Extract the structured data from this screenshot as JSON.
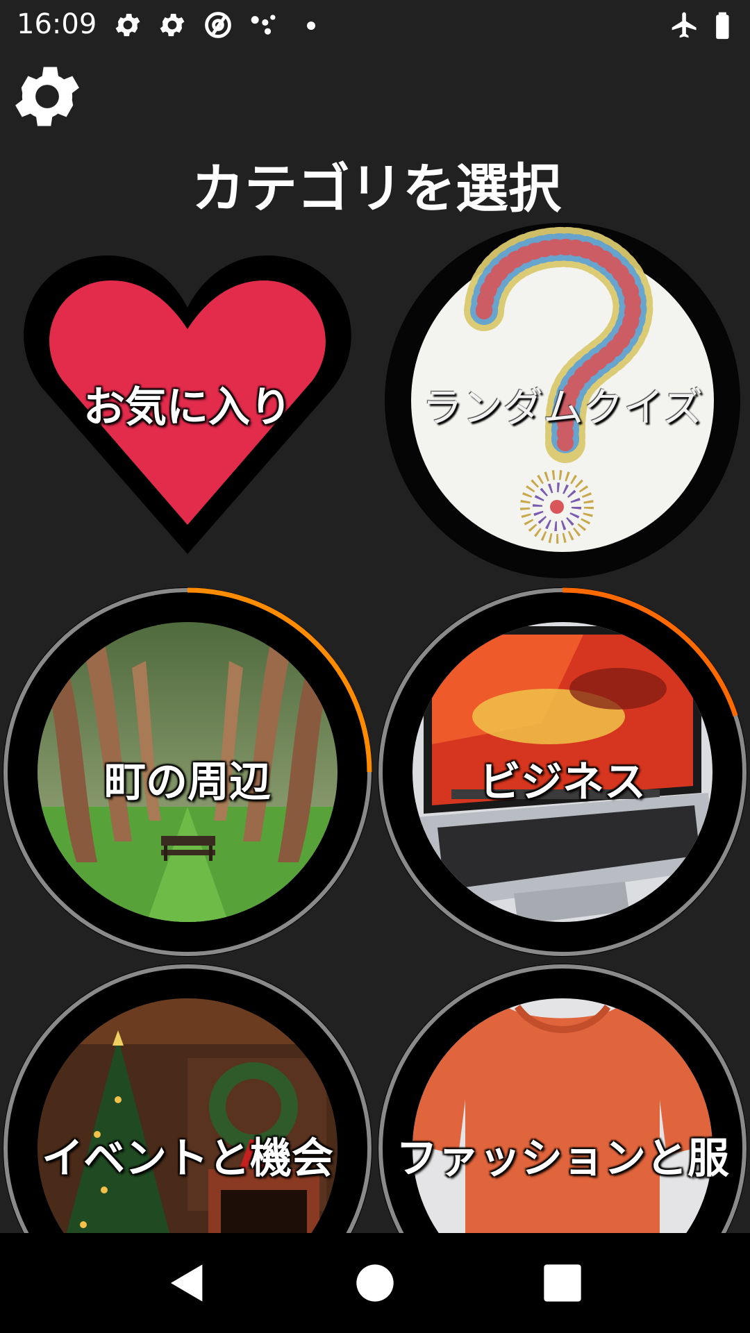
{
  "status_bar": {
    "time": "16:09",
    "icons": [
      "gear-icon",
      "gear-icon",
      "at-sign-icon",
      "dots-icon",
      "dot-icon",
      "airplane-icon",
      "battery-icon"
    ]
  },
  "settings_icon": "gear-icon",
  "title": "カテゴリを選択",
  "tiles": {
    "favorites": {
      "label": "お気に入り",
      "color": "#e32b4c"
    },
    "random_quiz": {
      "label": "ランダムクイズ"
    },
    "town": {
      "label": "町の周辺",
      "progress": 0.25
    },
    "business": {
      "label": "ビジネス",
      "progress": 0.2
    },
    "events": {
      "label": "イベントと機会"
    },
    "fashion": {
      "label": "ファッションと服"
    }
  },
  "colors": {
    "background": "#212121",
    "accent": "#ff8c00",
    "heart": "#e32b4c"
  },
  "nav": {
    "back": "back-icon",
    "home": "home-icon",
    "recents": "recents-icon"
  }
}
